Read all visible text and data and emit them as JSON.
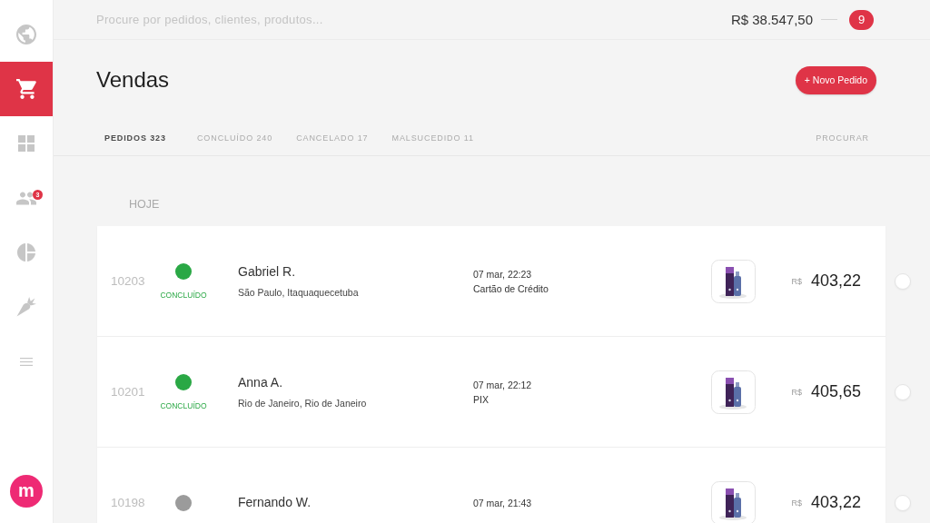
{
  "sidebar": {
    "items": [
      {
        "kind": "globe",
        "selected": false
      },
      {
        "kind": "cart",
        "selected": true
      },
      {
        "kind": "grid",
        "selected": false
      },
      {
        "kind": "people",
        "selected": false,
        "badge": "3"
      },
      {
        "kind": "pie",
        "selected": false
      },
      {
        "kind": "carrot",
        "selected": false
      },
      {
        "kind": "menu",
        "selected": false
      }
    ],
    "logo": "m"
  },
  "top_bar": {
    "search": {
      "placeholder": "Procure por pedidos, clientes, produtos..."
    },
    "balance": "R$ 38.547,50",
    "notifications": "9"
  },
  "header": {
    "title": "Vendas",
    "new_order_button": "+ Novo Pedido"
  },
  "tabs": [
    {
      "label": "PEDIDOS 323",
      "selected": true
    },
    {
      "label": "CONCLUÍDO 240",
      "selected": false
    },
    {
      "label": "CANCELADO 17",
      "selected": false
    },
    {
      "label": "MALSUCEDIDO 11",
      "selected": false
    }
  ],
  "search_link": "PROCURAR",
  "section": "HOJE",
  "orders": [
    {
      "number": "10203",
      "color": "#2aa845",
      "status": "CONCLUÍDO",
      "customer": "Gabriel R.",
      "location": "São Paulo, Itaquaquecetuba",
      "date": "07 mar, 22:23",
      "payment": "Cartão de Crédito",
      "currency": "R$",
      "total": "403,22",
      "selected": false
    },
    {
      "number": "10201",
      "color": "#2aa845",
      "status": "CONCLUÍDO",
      "customer": "Anna A.",
      "location": "Rio de Janeiro, Rio de Janeiro",
      "date": "07 mar, 22:12",
      "payment": "PIX",
      "currency": "R$",
      "total": "405,65",
      "selected": false
    },
    {
      "number": "10198",
      "color": "#9b9b9b",
      "customer": "Fernando W.",
      "date": "07 mar, 21:43",
      "currency": "R$",
      "total": "403,22",
      "selected": false
    }
  ]
}
